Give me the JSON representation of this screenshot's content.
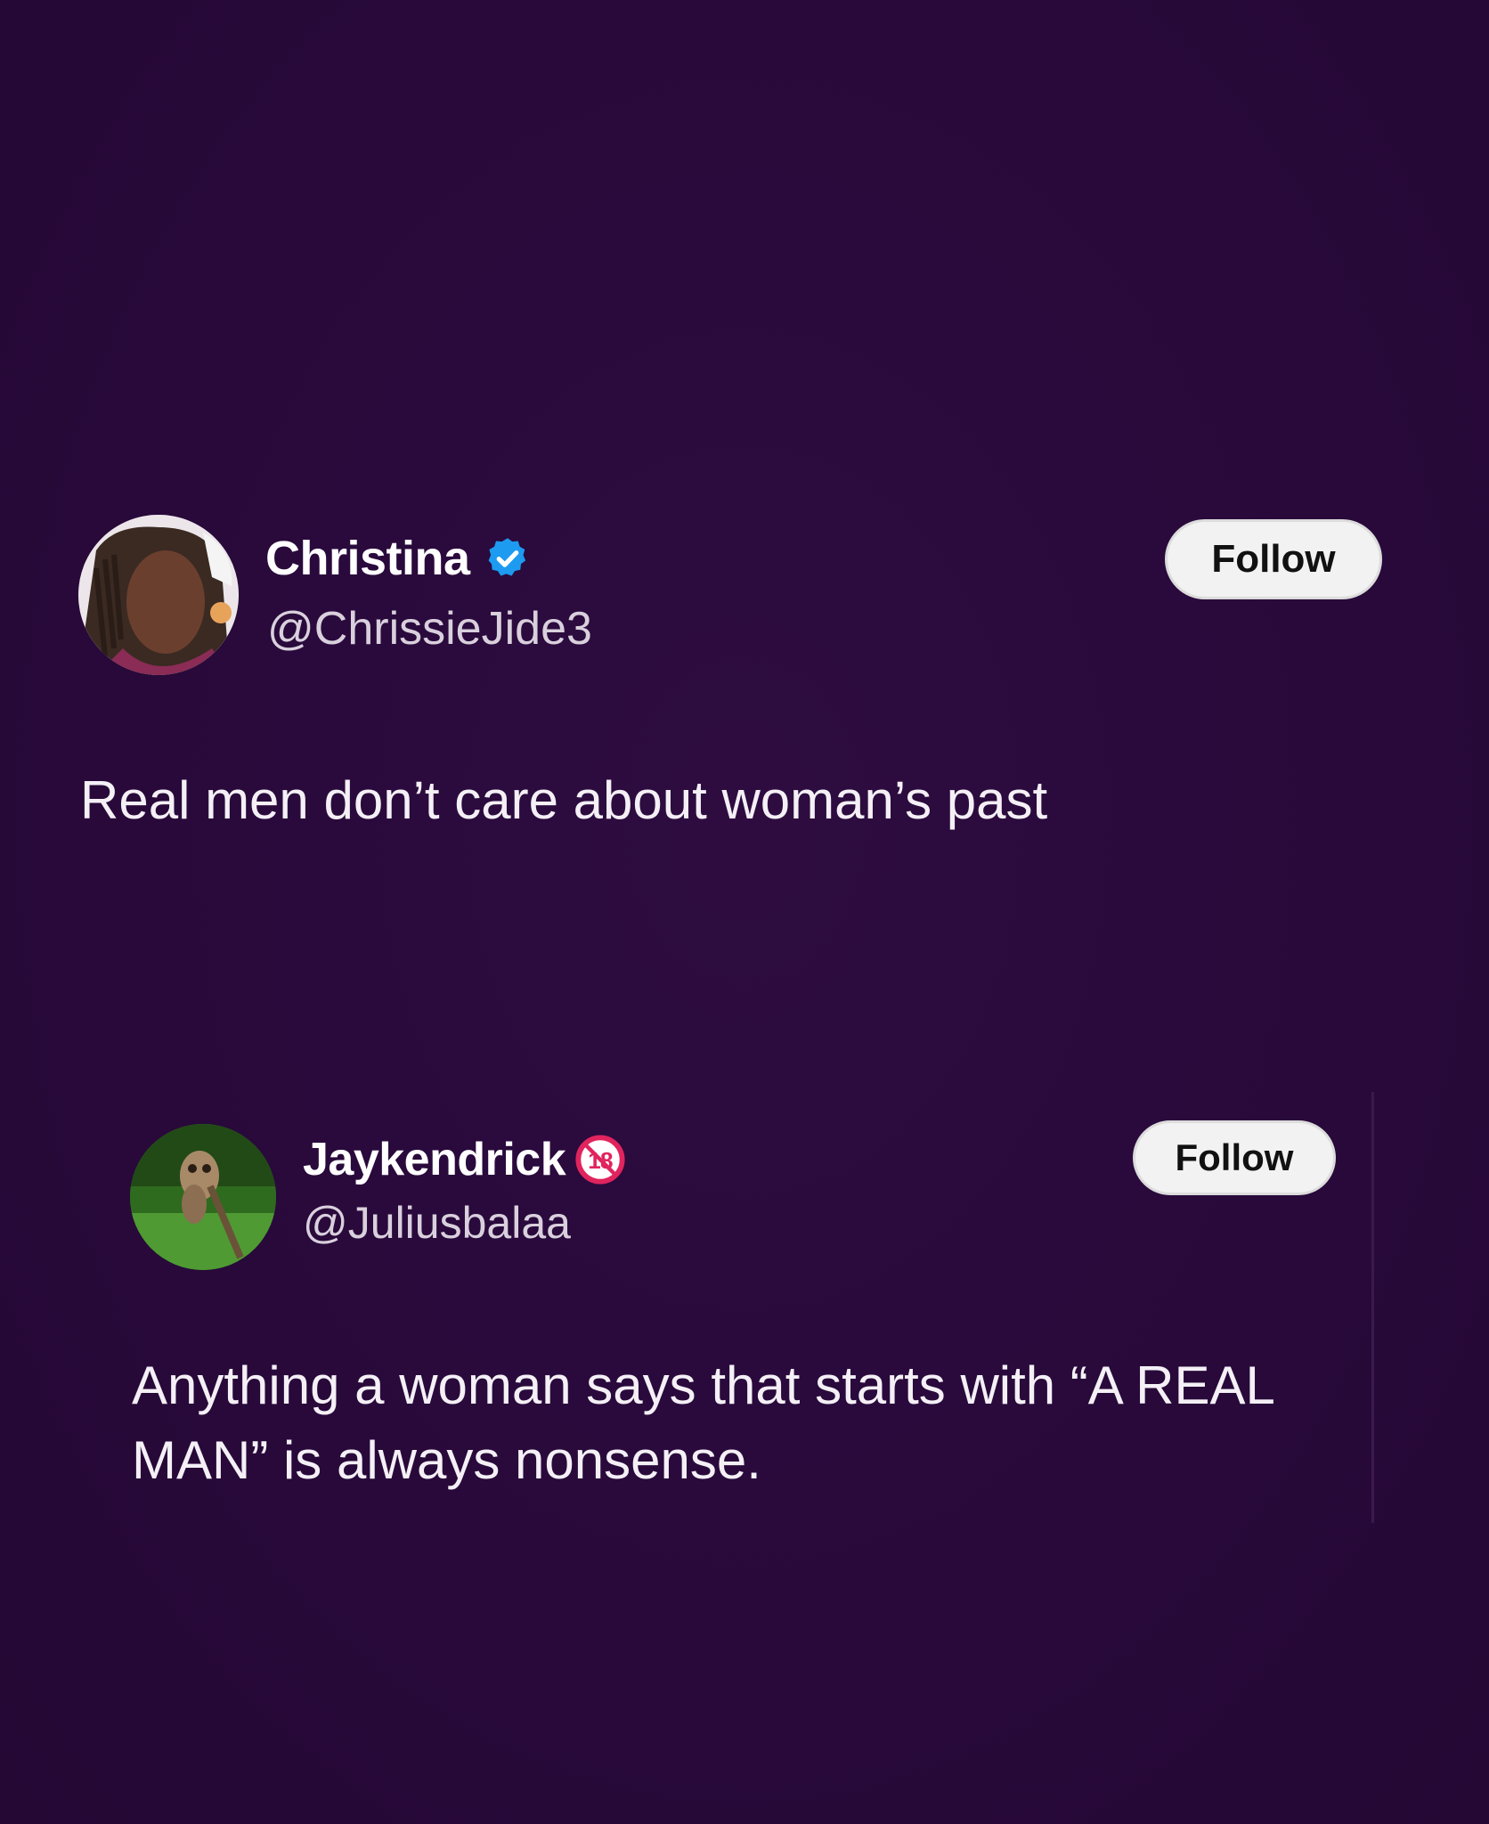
{
  "tweets": [
    {
      "author_name": "Christina",
      "handle": "@ChrissieJide3",
      "badge": "verified-icon",
      "follow_label": "Follow",
      "text": "Real men don’t care about woman’s past"
    },
    {
      "author_name": "Jaykendrick",
      "handle": "@Juliusbalaa",
      "badge": "18-plus-icon",
      "follow_label": "Follow",
      "text": "Anything a woman says that starts with “A REAL MAN” is always nonsense."
    }
  ],
  "colors": {
    "background": "#2a0a3a",
    "text": "#ffffff",
    "handle": "#d9d0dd",
    "verified": "#1d9bf0",
    "badge_18": "#e0245e",
    "button_bg": "#f2f2f2",
    "button_text": "#111111"
  }
}
